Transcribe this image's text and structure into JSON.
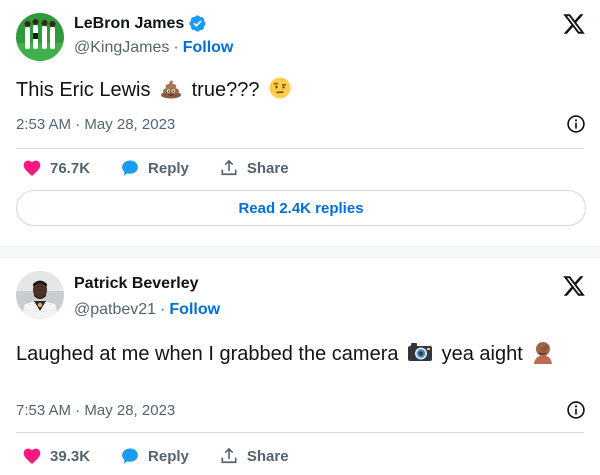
{
  "tweets": [
    {
      "author_name": "LeBron James",
      "handle": "@KingJames",
      "separator": "·",
      "follow_label": "Follow",
      "text_before": "This Eric Lewis",
      "text_middle": "true???",
      "timestamp": "2:53 AM · May 28, 2023",
      "likes": "76.7K",
      "reply_label": "Reply",
      "share_label": "Share",
      "read_replies_label": "Read 2.4K replies",
      "verified": true,
      "emojis": [
        "pile-of-poo-emoji",
        "face-with-raised-eyebrow-emoji"
      ]
    },
    {
      "author_name": "Patrick Beverley",
      "handle": "@patbev21",
      "separator": "·",
      "follow_label": "Follow",
      "text_before": "Laughed at me when I grabbed the camera",
      "text_middle": "yea aight",
      "timestamp": "7:53 AM · May 28, 2023",
      "likes": "39.3K",
      "reply_label": "Reply",
      "share_label": "Share",
      "verified": false,
      "emojis": [
        "camera-emoji",
        "person-facepalming-emoji"
      ]
    }
  ],
  "colors": {
    "accent": "#006fd6",
    "like": "#f91880",
    "reply": "#1d9bf0",
    "muted": "#536471",
    "text": "#0f1419"
  }
}
